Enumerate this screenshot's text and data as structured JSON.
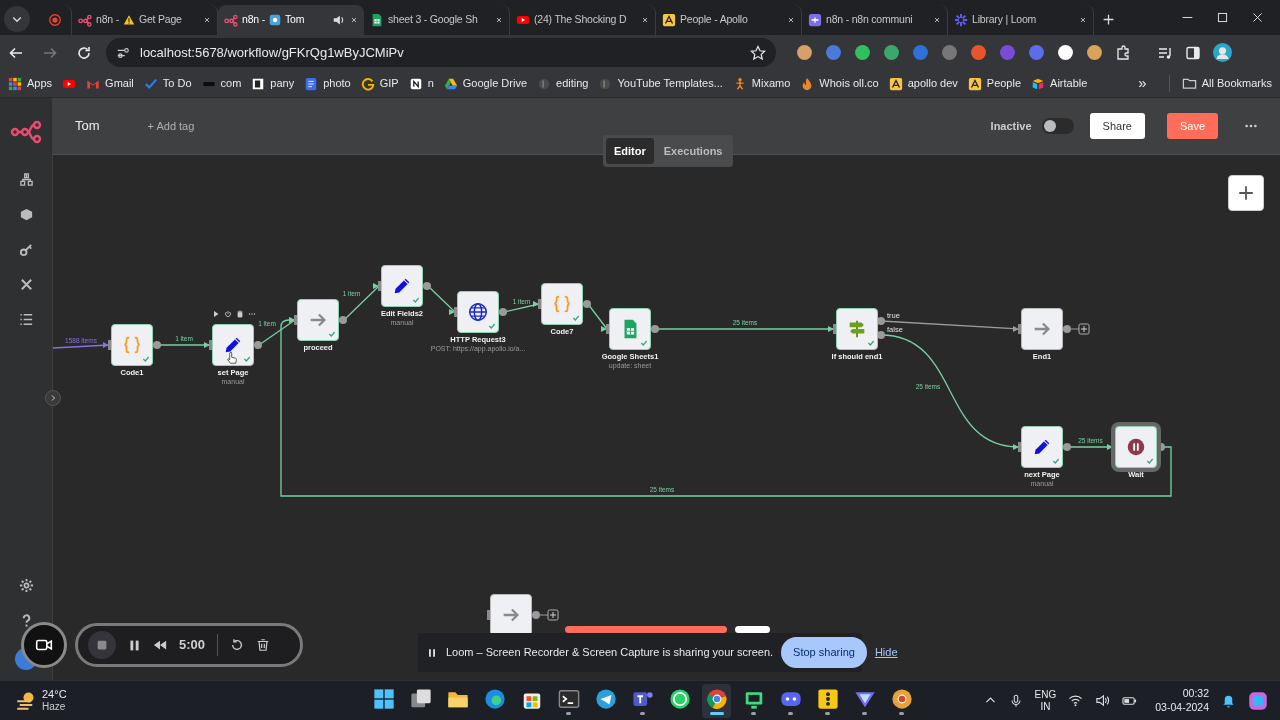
{
  "browser": {
    "tabs": [
      {
        "kind": "record",
        "audio": false,
        "selected": false
      },
      {
        "kind": "n8n",
        "prefix": "n8n -",
        "warning": true,
        "sharing": false,
        "title": "Get Page",
        "audio": false,
        "selected": false
      },
      {
        "kind": "n8n",
        "prefix": "n8n -",
        "warning": false,
        "sharing": true,
        "title": "Tom",
        "audio": true,
        "selected": true
      },
      {
        "kind": "sheets",
        "title": "sheet 3 - Google Sh",
        "audio": false,
        "selected": false
      },
      {
        "kind": "youtube",
        "title": "(24) The Shocking D",
        "audio": false,
        "selected": false
      },
      {
        "kind": "apollo",
        "title": "People - Apollo",
        "audio": false,
        "selected": false
      },
      {
        "kind": "community",
        "title": "n8n - n8n communi",
        "audio": false,
        "selected": false
      },
      {
        "kind": "loom",
        "title": "Library | Loom",
        "audio": false,
        "selected": false
      }
    ],
    "url": "localhost:5678/workflow/gFKrQg1wByJCMiPv",
    "bookmarks": [
      {
        "kind": "apps",
        "label": "Apps"
      },
      {
        "kind": "youtube"
      },
      {
        "kind": "gmail",
        "label": "Gmail"
      },
      {
        "kind": "todo",
        "label": "To Do"
      },
      {
        "kind": "dark",
        "label": "com"
      },
      {
        "kind": "box",
        "label": "pany"
      },
      {
        "kind": "doc",
        "label": "photo"
      },
      {
        "kind": "gip",
        "label": "GIP"
      },
      {
        "kind": "notion",
        "label": "n"
      },
      {
        "kind": "drive",
        "label": "Google Drive"
      },
      {
        "kind": "page",
        "label": "editing"
      },
      {
        "kind": "page",
        "label": "YouTube Templates..."
      },
      {
        "kind": "figure",
        "label": "Mixamo"
      },
      {
        "kind": "flame",
        "label": "Whois oll.co"
      },
      {
        "kind": "apollo",
        "label": "apollo dev"
      },
      {
        "kind": "apollo",
        "label": "People"
      },
      {
        "kind": "airtable",
        "label": "Airtable"
      }
    ],
    "bookmarks_more": "»",
    "all_bookmarks": "All Bookmarks"
  },
  "app": {
    "workflow_name": "Tom",
    "add_tag": "+ Add tag",
    "active_label": "Inactive",
    "active": false,
    "share": "Share",
    "save": "Save",
    "view_tabs": [
      {
        "label": "Editor",
        "selected": true
      },
      {
        "label": "Executions",
        "selected": false
      }
    ],
    "sidebar": {
      "items": [
        {
          "kind": "workflows"
        },
        {
          "kind": "templates"
        },
        {
          "kind": "credentials"
        },
        {
          "kind": "variables"
        },
        {
          "kind": "executions"
        }
      ],
      "footer": [
        {
          "kind": "settings"
        },
        {
          "kind": "help"
        },
        {
          "kind": "avatar"
        }
      ]
    },
    "canvas": {
      "nodes": [
        {
          "kind": "code",
          "label": "Code1",
          "executed": true,
          "selected": false,
          "hovered": false,
          "add_output": false
        },
        {
          "kind": "set",
          "label": "set Page",
          "subtitle": "manual",
          "executed": true,
          "selected": false,
          "hovered": true,
          "add_output": false
        },
        {
          "kind": "noop",
          "label": "proceed",
          "executed": true,
          "selected": false,
          "hovered": false,
          "add_output": false
        },
        {
          "kind": "set",
          "label": "Edit Fields2",
          "subtitle": "manual",
          "executed": true,
          "selected": false,
          "hovered": false,
          "add_output": false
        },
        {
          "kind": "http",
          "label": "HTTP Request3",
          "subtitle": "POST: https://app.apollo.io/a...",
          "executed": true,
          "selected": false,
          "hovered": false,
          "add_output": false
        },
        {
          "kind": "code",
          "label": "Code7",
          "executed": true,
          "selected": false,
          "hovered": false,
          "add_output": false
        },
        {
          "kind": "sheets",
          "label": "Google Sheets1",
          "subtitle": "update: sheet",
          "executed": true,
          "selected": false,
          "hovered": false,
          "add_output": false
        },
        {
          "kind": "if",
          "label": "If should end1",
          "outputs": [
            "true",
            "false"
          ],
          "executed": true,
          "selected": false,
          "hovered": false,
          "add_output": false
        },
        {
          "kind": "noop",
          "label": "End1",
          "executed": false,
          "selected": false,
          "hovered": false,
          "add_output": true
        },
        {
          "kind": "set",
          "label": "next Page",
          "subtitle": "manual",
          "executed": true,
          "selected": false,
          "hovered": false,
          "add_output": false
        },
        {
          "kind": "wait",
          "label": "Wait",
          "executed": true,
          "selected": true,
          "hovered": false,
          "add_output": false
        },
        {
          "kind": "noop",
          "executed": false,
          "selected": false,
          "hovered": false,
          "add_output": true
        }
      ],
      "edges": [
        {
          "kind": "input",
          "label": "1588 items"
        },
        {
          "kind": "main",
          "label": "1 item"
        },
        {
          "kind": "main",
          "label": "1 item"
        },
        {
          "kind": "main",
          "label": "1 item"
        },
        {
          "kind": "main"
        },
        {
          "kind": "main",
          "label": "1 item"
        },
        {
          "kind": "main"
        },
        {
          "kind": "main",
          "label": "25 items"
        },
        {
          "kind": "inactive"
        },
        {
          "kind": "main",
          "label": "25 items"
        },
        {
          "kind": "main",
          "label": "25 items"
        },
        {
          "kind": "main",
          "label": "25 items"
        }
      ]
    }
  },
  "loom": {
    "recorder": {
      "time": "5:00"
    },
    "notice": {
      "message": "Loom – Screen Recorder & Screen Capture is sharing your screen.",
      "stop": "Stop sharing",
      "hide": "Hide"
    }
  },
  "taskbar": {
    "weather": {
      "temp": "24°C",
      "condition": "Haze"
    },
    "apps": [
      {
        "kind": "start",
        "running": false,
        "selected": false
      },
      {
        "kind": "taskview",
        "running": false,
        "selected": false
      },
      {
        "kind": "explorer",
        "running": false,
        "selected": false
      },
      {
        "kind": "edge",
        "running": false,
        "selected": false
      },
      {
        "kind": "store",
        "running": false,
        "selected": false
      },
      {
        "kind": "terminal",
        "running": true,
        "selected": false
      },
      {
        "kind": "telegram",
        "running": false,
        "selected": false
      },
      {
        "kind": "teams",
        "running": true,
        "selected": false
      },
      {
        "kind": "whatsapp",
        "running": false,
        "selected": false
      },
      {
        "kind": "chrome",
        "running": true,
        "selected": true
      },
      {
        "kind": "android",
        "running": true,
        "selected": false
      },
      {
        "kind": "discord",
        "running": true,
        "selected": false
      },
      {
        "kind": "yellow",
        "running": true,
        "selected": false
      },
      {
        "kind": "vpn",
        "running": true,
        "selected": false
      },
      {
        "kind": "canary",
        "running": true,
        "selected": false
      }
    ],
    "language": "ENG",
    "region": "IN",
    "time": "00:32",
    "date": "03-04-2024"
  }
}
